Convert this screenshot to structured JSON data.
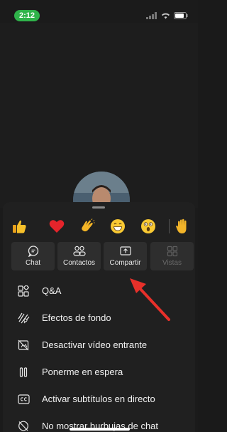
{
  "status_bar": {
    "time": "2:12"
  },
  "reactions": [
    {
      "icon": "thumbs-up-icon"
    },
    {
      "icon": "heart-icon"
    },
    {
      "icon": "clapping-hands-icon"
    },
    {
      "icon": "laughing-face-icon"
    },
    {
      "icon": "surprised-face-icon"
    },
    {
      "icon": "raised-hand-icon"
    }
  ],
  "actions": {
    "chat": "Chat",
    "contacts": "Contactos",
    "share": "Compartir",
    "views": "Vistas"
  },
  "menu": {
    "qa": "Q&A",
    "background_effects": "Efectos de fondo",
    "disable_incoming_video": "Desactivar vídeo entrante",
    "hold": "Ponerme en espera",
    "live_captions": "Activar subtítulos en directo",
    "hide_chat_bubbles": "No mostrar burbujas de chat"
  },
  "colors": {
    "status_time_bg": "#2fb34a",
    "annotation_arrow": "#e8302a",
    "sheet_bg": "#202020",
    "button_bg": "#2e2e2e"
  }
}
